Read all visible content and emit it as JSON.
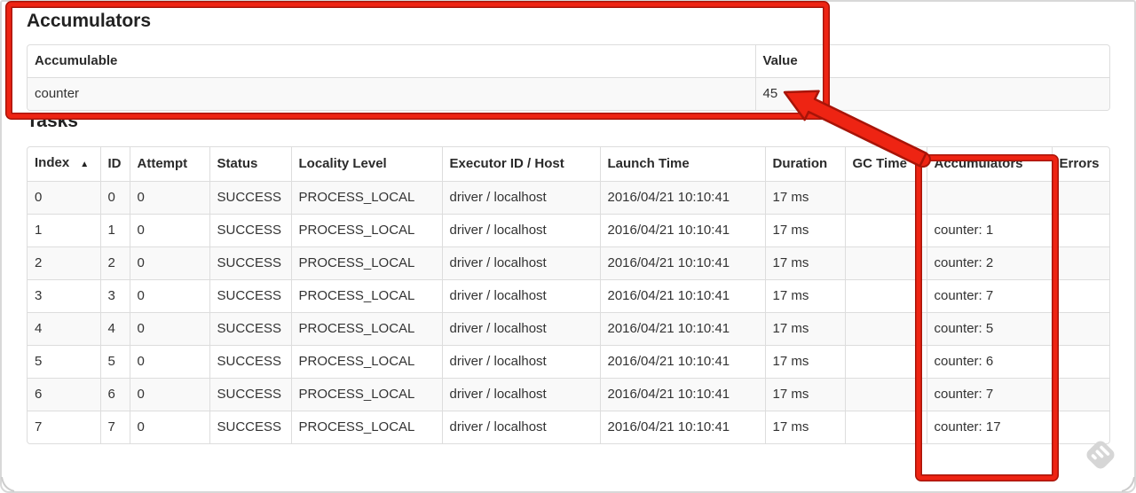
{
  "accumulators_section": {
    "heading": "Accumulators",
    "table": {
      "headers": [
        "Accumulable",
        "Value"
      ],
      "rows": [
        [
          "counter",
          "45"
        ]
      ]
    }
  },
  "tasks_section": {
    "heading": "Tasks",
    "table": {
      "headers": [
        "Index",
        "ID",
        "Attempt",
        "Status",
        "Locality Level",
        "Executor ID / Host",
        "Launch Time",
        "Duration",
        "GC Time",
        "Accumulators",
        "Errors"
      ],
      "sort_indicator": "▲",
      "rows": [
        [
          "0",
          "0",
          "0",
          "SUCCESS",
          "PROCESS_LOCAL",
          "driver / localhost",
          "2016/04/21 10:10:41",
          "17 ms",
          "",
          "",
          ""
        ],
        [
          "1",
          "1",
          "0",
          "SUCCESS",
          "PROCESS_LOCAL",
          "driver / localhost",
          "2016/04/21 10:10:41",
          "17 ms",
          "",
          "counter: 1",
          ""
        ],
        [
          "2",
          "2",
          "0",
          "SUCCESS",
          "PROCESS_LOCAL",
          "driver / localhost",
          "2016/04/21 10:10:41",
          "17 ms",
          "",
          "counter: 2",
          ""
        ],
        [
          "3",
          "3",
          "0",
          "SUCCESS",
          "PROCESS_LOCAL",
          "driver / localhost",
          "2016/04/21 10:10:41",
          "17 ms",
          "",
          "counter: 7",
          ""
        ],
        [
          "4",
          "4",
          "0",
          "SUCCESS",
          "PROCESS_LOCAL",
          "driver / localhost",
          "2016/04/21 10:10:41",
          "17 ms",
          "",
          "counter: 5",
          ""
        ],
        [
          "5",
          "5",
          "0",
          "SUCCESS",
          "PROCESS_LOCAL",
          "driver / localhost",
          "2016/04/21 10:10:41",
          "17 ms",
          "",
          "counter: 6",
          ""
        ],
        [
          "6",
          "6",
          "0",
          "SUCCESS",
          "PROCESS_LOCAL",
          "driver / localhost",
          "2016/04/21 10:10:41",
          "17 ms",
          "",
          "counter: 7",
          ""
        ],
        [
          "7",
          "7",
          "0",
          "SUCCESS",
          "PROCESS_LOCAL",
          "driver / localhost",
          "2016/04/21 10:10:41",
          "17 ms",
          "",
          "counter: 17",
          ""
        ]
      ]
    }
  },
  "annotations": {
    "highlight_color": "#ee2413",
    "highlight_edge_color": "#a81408",
    "watermark_color": "#d6d6d6"
  }
}
